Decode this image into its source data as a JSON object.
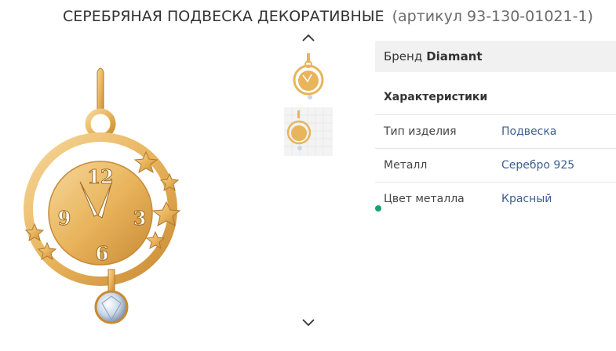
{
  "product": {
    "title": "СЕРЕБРЯНАЯ ПОДВЕСКА ДЕКОРАТИВНЫЕ",
    "article": "(артикул 93-130-01021-1)"
  },
  "gallery": {
    "main_image_icon": "clock-pendant-image",
    "clock_numbers": [
      "12",
      "3",
      "6",
      "9"
    ],
    "prev_icon": "chevron-up-icon",
    "next_icon": "chevron-down-icon",
    "thumbnails": [
      {
        "icon": "clock-pendant-thumbnail"
      },
      {
        "icon": "clock-pendant-thumbnail-grid"
      }
    ]
  },
  "specs": {
    "brand_label": "Бренд",
    "brand_value": "Diamant",
    "section_title": "Характеристики",
    "rows": [
      {
        "label": "Тип изделия",
        "value": "Подвеска"
      },
      {
        "label": "Металл",
        "value": "Серебро 925"
      },
      {
        "label": "Цвет металла",
        "value": "Красный"
      }
    ]
  },
  "colors": {
    "gold": "#e8b45c",
    "link": "#3b5f8f",
    "status_dot": "#16a56a"
  }
}
